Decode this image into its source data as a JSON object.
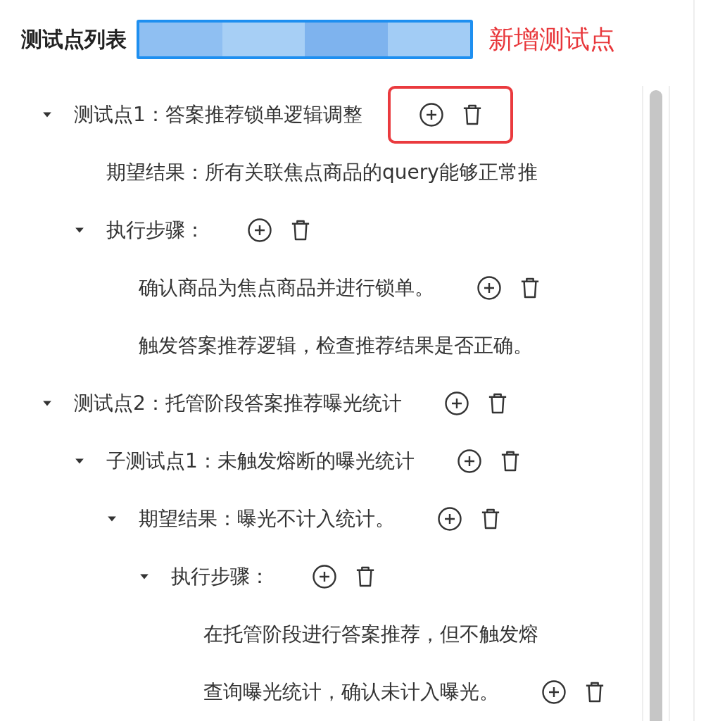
{
  "header": {
    "title": "测试点列表",
    "add_link": "新增测试点"
  },
  "tree": [
    {
      "label": "测试点1：答案推荐锁单逻辑调整",
      "expanded": true,
      "actions": true,
      "highlighted": true,
      "children": [
        {
          "label": "期望结果：所有关联焦点商品的query能够正常推",
          "actions": false,
          "highlighted": false
        },
        {
          "label": "执行步骤：",
          "expanded": true,
          "actions": true,
          "highlighted": false,
          "children": [
            {
              "label": "确认商品为焦点商品并进行锁单。",
              "actions": true,
              "highlighted": false
            },
            {
              "label": "触发答案推荐逻辑，检查推荐结果是否正确。",
              "actions": false,
              "highlighted": false
            }
          ]
        }
      ]
    },
    {
      "label": "测试点2：托管阶段答案推荐曝光统计",
      "expanded": true,
      "actions": true,
      "highlighted": false,
      "children": [
        {
          "label": "子测试点1：未触发熔断的曝光统计",
          "expanded": true,
          "actions": true,
          "highlighted": false,
          "children": [
            {
              "label": "期望结果：曝光不计入统计。",
              "expanded": true,
              "actions": true,
              "highlighted": false,
              "children": [
                {
                  "label": "执行步骤：",
                  "expanded": true,
                  "actions": true,
                  "highlighted": false,
                  "children": [
                    {
                      "label": "在托管阶段进行答案推荐，但不触发熔",
                      "actions": false,
                      "highlighted": false
                    },
                    {
                      "label": "查询曝光统计，确认未计入曝光。",
                      "actions": true,
                      "highlighted": false
                    }
                  ]
                }
              ]
            }
          ]
        }
      ]
    }
  ]
}
